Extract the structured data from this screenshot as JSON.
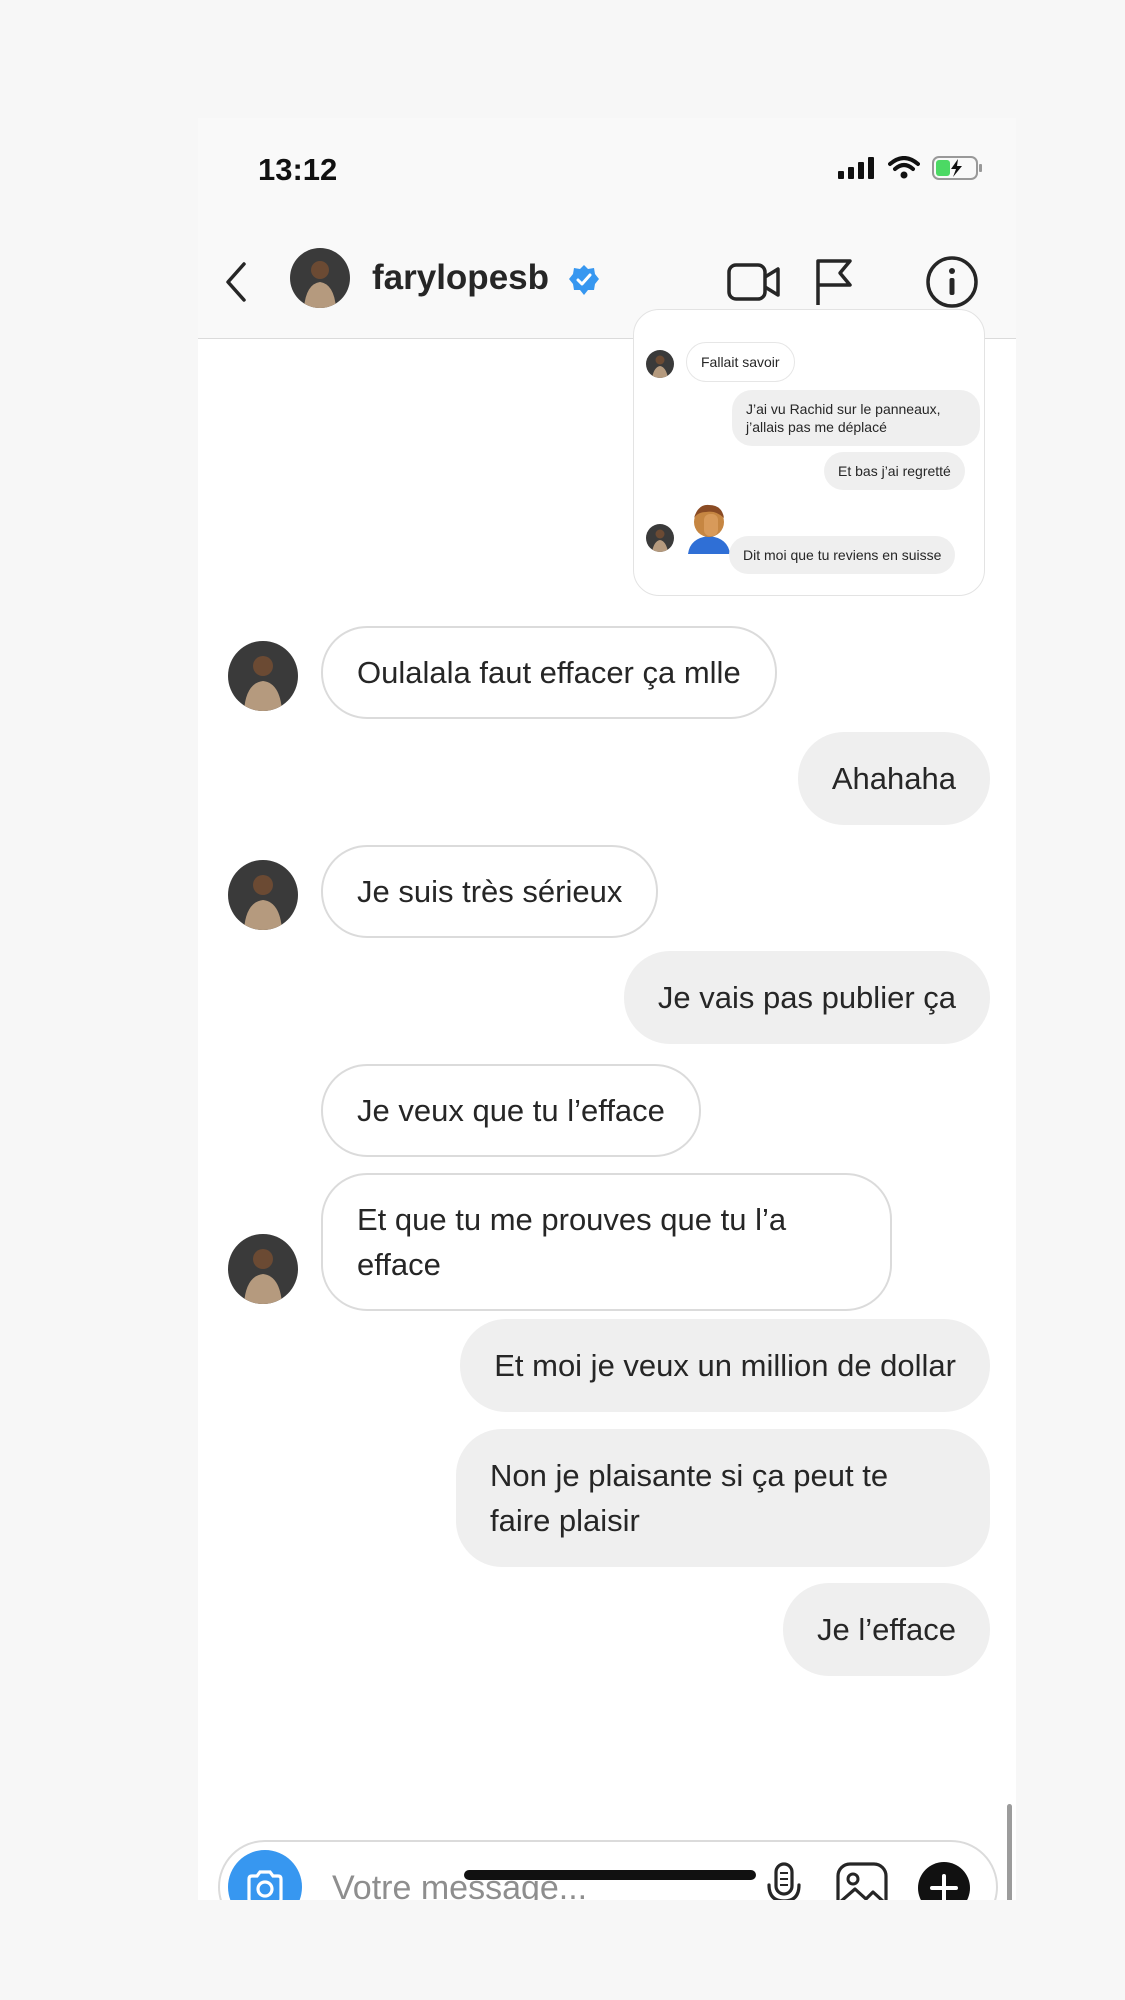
{
  "status": {
    "time": "13:12"
  },
  "header": {
    "username": "farylopesb"
  },
  "shared_card": {
    "messages": [
      {
        "text": "Fallait savoir"
      },
      {
        "text": "J’ai vu Rachid sur le panneaux, j’allais pas me déplacé"
      },
      {
        "text": "Et bas j’ai regretté"
      },
      {
        "text": "Dit moi que tu reviens en suisse"
      }
    ]
  },
  "messages": [
    {
      "text": "Oulalala faut effacer ça mlle",
      "sender": "them"
    },
    {
      "text": "Ahahaha",
      "sender": "me"
    },
    {
      "text": "Je suis très sérieux",
      "sender": "them"
    },
    {
      "text": "Je vais pas publier ça",
      "sender": "me"
    },
    {
      "text": "Je veux que tu l’efface",
      "sender": "them"
    },
    {
      "text": "Et que tu me prouves que tu l’a efface",
      "sender": "them"
    },
    {
      "text": "Et moi je veux un million de dollar",
      "sender": "me"
    },
    {
      "text": "Non je plaisante si ça peut te faire plaisir",
      "sender": "me"
    },
    {
      "text": "Je l’efface",
      "sender": "me"
    }
  ],
  "composer": {
    "placeholder": "Votre message..."
  },
  "colors": {
    "accent": "#3797f0",
    "incoming_bg": "#ffffff",
    "outgoing_bg": "#efefef"
  }
}
